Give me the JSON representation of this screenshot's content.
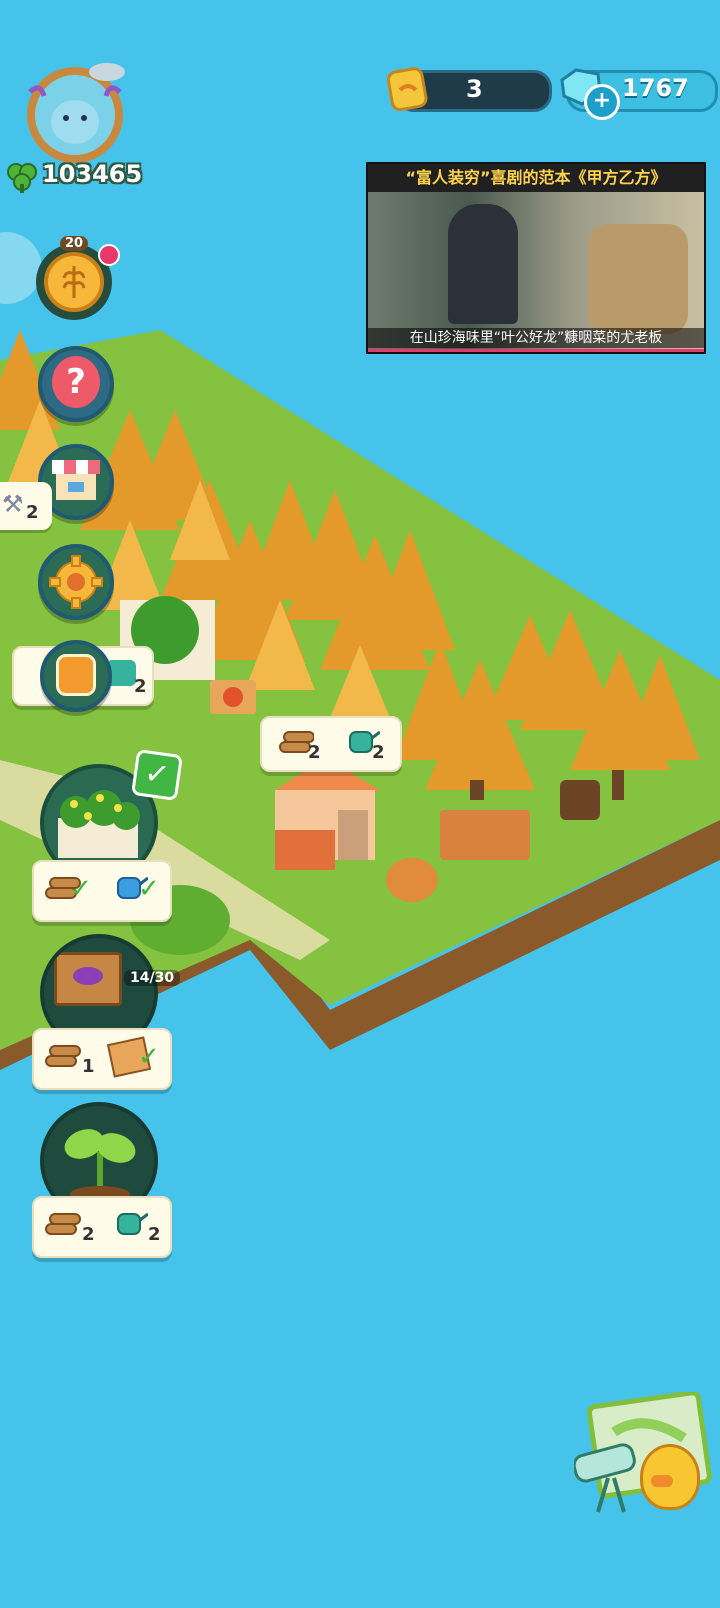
{
  "player": {
    "clover_count": "103465",
    "level": "20"
  },
  "resources": {
    "seed_count": "3",
    "gem_count": "1767"
  },
  "video_ad": {
    "top_caption": "“富人装穷”喜剧的范本《甲方乙方》",
    "bottom_caption": "在山珍海味里“叶公好龙”糠咽菜的尤老板"
  },
  "side_tools": {
    "shovel_count": "2",
    "watering_count": "2"
  },
  "market_popup": {
    "wood_count": "2",
    "water_count": "2"
  },
  "farm_cards": [
    {
      "wood": "",
      "water": "",
      "state": "done"
    },
    {
      "wood": "1",
      "progress": "14/30",
      "state": "partial"
    },
    {
      "wood": "2",
      "water": "2",
      "state": "need"
    }
  ],
  "icons": [
    "clover-icon",
    "seed-bag-icon",
    "gem-icon",
    "plus-icon",
    "wheat-coin-icon",
    "question-icon",
    "shop-icon",
    "gear-icon",
    "fruit-jar-icon",
    "wood-logs-icon",
    "watering-can-icon",
    "check-icon",
    "eggplant-sign-icon",
    "sprout-icon",
    "telescope-map-icon",
    "duck-icon",
    "shovel-icon"
  ]
}
